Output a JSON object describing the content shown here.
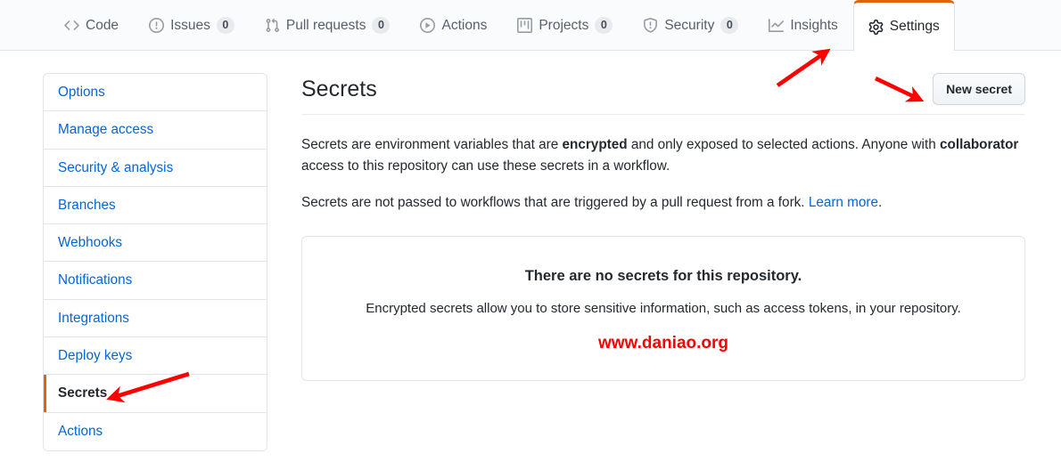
{
  "repo_nav": {
    "tabs": [
      {
        "label": "Code",
        "icon": "code-icon",
        "count": null,
        "selected": false
      },
      {
        "label": "Issues",
        "icon": "issue-opened-icon",
        "count": "0",
        "selected": false
      },
      {
        "label": "Pull requests",
        "icon": "git-pull-request-icon",
        "count": "0",
        "selected": false
      },
      {
        "label": "Actions",
        "icon": "play-icon",
        "count": null,
        "selected": false
      },
      {
        "label": "Projects",
        "icon": "project-icon",
        "count": "0",
        "selected": false
      },
      {
        "label": "Security",
        "icon": "shield-icon",
        "count": "0",
        "selected": false
      },
      {
        "label": "Insights",
        "icon": "graph-icon",
        "count": null,
        "selected": false
      },
      {
        "label": "Settings",
        "icon": "gear-icon",
        "count": null,
        "selected": true
      }
    ]
  },
  "sidebar": {
    "items": [
      {
        "label": "Options",
        "selected": false
      },
      {
        "label": "Manage access",
        "selected": false
      },
      {
        "label": "Security & analysis",
        "selected": false
      },
      {
        "label": "Branches",
        "selected": false
      },
      {
        "label": "Webhooks",
        "selected": false
      },
      {
        "label": "Notifications",
        "selected": false
      },
      {
        "label": "Integrations",
        "selected": false
      },
      {
        "label": "Deploy keys",
        "selected": false
      },
      {
        "label": "Secrets",
        "selected": true
      },
      {
        "label": "Actions",
        "selected": false
      }
    ]
  },
  "main": {
    "title": "Secrets",
    "new_secret_button": "New secret",
    "paragraph1": {
      "part1": "Secrets are environment variables that are ",
      "bold1": "encrypted",
      "part2": " and only exposed to selected actions. Anyone with ",
      "bold2": "collaborator",
      "part3": " access to this repository can use these secrets in a workflow."
    },
    "paragraph2": {
      "text": "Secrets are not passed to workflows that are triggered by a pull request from a fork. ",
      "link": "Learn more",
      "suffix": "."
    },
    "blankslate": {
      "title": "There are no secrets for this repository.",
      "subtitle": "Encrypted secrets allow you to store sensitive information, such as access tokens, in your repository.",
      "watermark": "www.daniao.org"
    }
  },
  "annotations": {
    "arrow_color": "#ff0000",
    "arrows": [
      {
        "name": "arrow-to-settings-tab",
        "direction": "up-right"
      },
      {
        "name": "arrow-to-new-secret-button",
        "direction": "right-down"
      },
      {
        "name": "arrow-to-secrets-sidebar",
        "direction": "left"
      }
    ]
  },
  "theme": {
    "accent_orange": "#e36209",
    "link_blue": "#0366d6",
    "text_dark": "#24292e",
    "text_muted": "#586069",
    "border": "#e1e4e8",
    "nav_bg": "#fafbfc",
    "watermark_red": "#ff0000"
  }
}
